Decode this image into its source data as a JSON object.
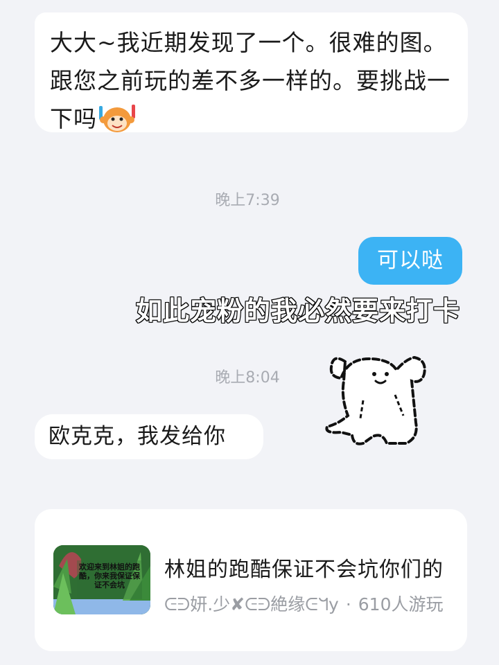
{
  "messages": [
    {
      "side": "left",
      "text": "大大~我近期发现了一个。很难的图。跟您之前玩的差不多一样的。要挑战一下吗",
      "emoji": "monkey-face-emoji"
    },
    {
      "side": "right",
      "text": "可以哒"
    },
    {
      "side": "left",
      "text": "欧克克，我发给你"
    }
  ],
  "timestamps": [
    "晚上7:39",
    "晚上8:04"
  ],
  "overlay_caption": "如此宠粉的我必然要来打卡",
  "sticker": "white-puppy-dancing-sticker",
  "shared_card": {
    "thumbnail_text": "欢迎来到林姐的跑酷，你来我保证保证不会坑",
    "title": "林姐的跑酷保证不会坑你们的",
    "author": "ᕮᕭ妍.少✘ᕮᕭ絶缘ᕮᖻy",
    "separator": "·",
    "players": "610人游玩"
  },
  "colors": {
    "background": "#f2f3f7",
    "bubble_left": "#ffffff",
    "bubble_right": "#3cb3f4",
    "timestamp": "#a8abb2"
  }
}
